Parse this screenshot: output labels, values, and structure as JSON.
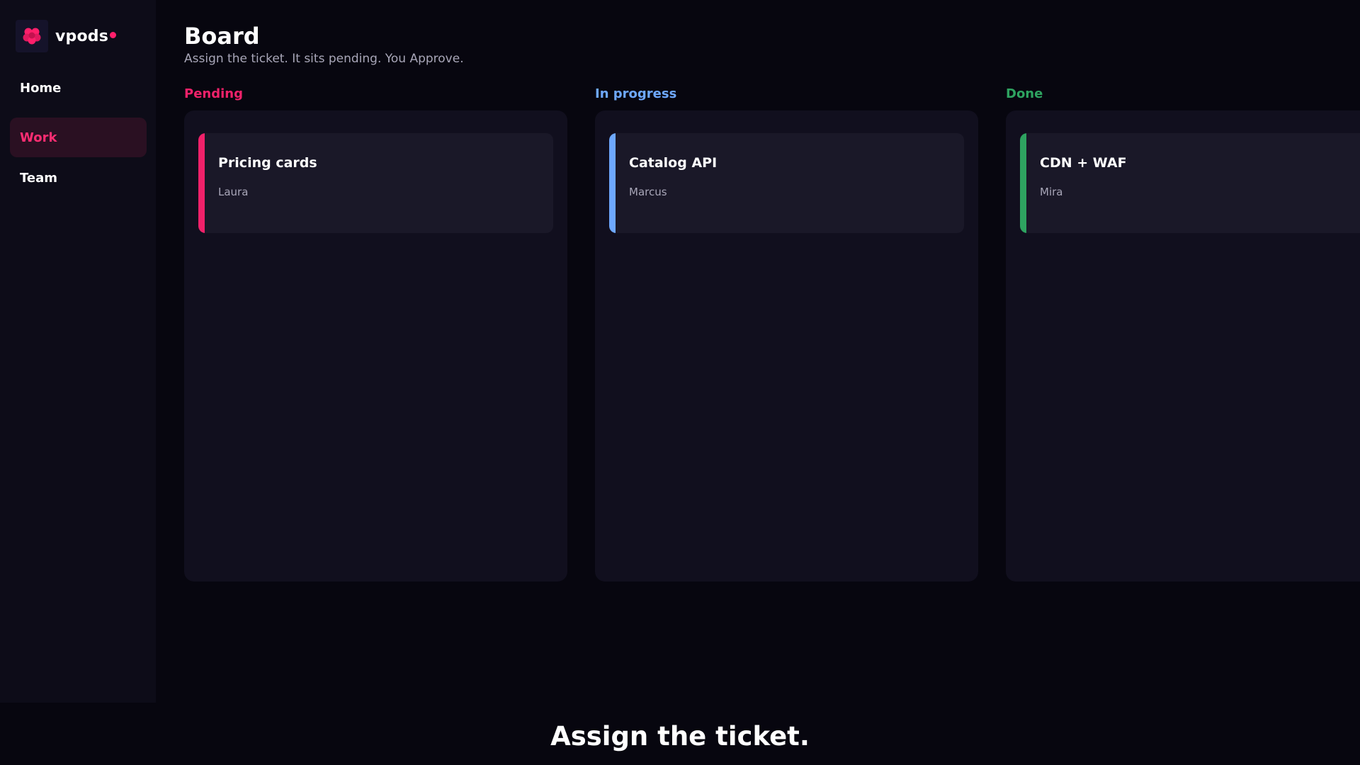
{
  "brand": {
    "name": "vpods",
    "accent": "#ff1f6b",
    "logo_icon": "flower-logo-icon"
  },
  "sidebar": {
    "items": [
      {
        "label": "Home",
        "active": false
      },
      {
        "label": "Work",
        "active": true
      },
      {
        "label": "Team",
        "active": false
      }
    ]
  },
  "header": {
    "title": "Board",
    "subtitle": "Assign the ticket. It sits pending. You Approve."
  },
  "columns": [
    {
      "label": "Pending",
      "color": "#f0216a",
      "cards": [
        {
          "title": "Pricing cards",
          "assignee": "Laura"
        }
      ]
    },
    {
      "label": "In progress",
      "color": "#6ea8ff",
      "cards": [
        {
          "title": "Catalog API",
          "assignee": "Marcus"
        }
      ]
    },
    {
      "label": "Done",
      "color": "#2ea360",
      "cards": [
        {
          "title": "CDN + WAF",
          "assignee": "Mira"
        }
      ]
    }
  ],
  "caption": "Assign the ticket."
}
